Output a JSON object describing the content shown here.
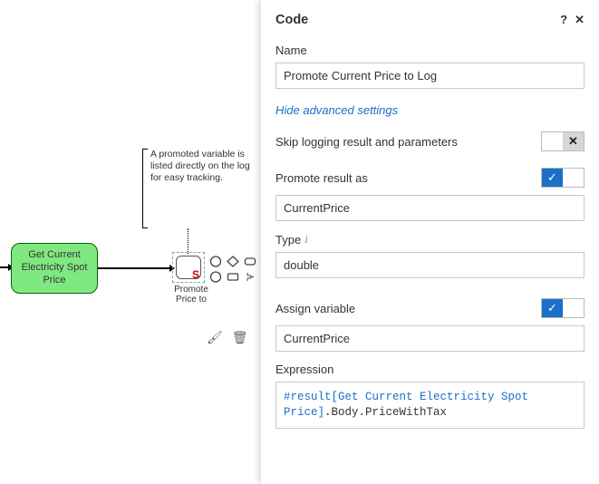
{
  "canvas": {
    "green_node_label": "Get Current Electricity Spot Price",
    "small_node_label": "Promote Price to",
    "small_node_badge": "S",
    "note_text": "A promoted variable is listed directly on the log for easy tracking."
  },
  "palette": {
    "shapes": [
      "circle",
      "diamond",
      "rounded-rect",
      "circle",
      "rect",
      "bracket"
    ],
    "tools": {
      "brush": "🖌",
      "trash": "🗑"
    }
  },
  "panel": {
    "title": "Code",
    "help_icon": "?",
    "close_icon": "✕",
    "name_label": "Name",
    "name_value": "Promote Current Price to Log",
    "hide_advanced_label": "Hide advanced settings",
    "skip_logging_label": "Skip logging result and parameters",
    "skip_logging_on": false,
    "promote_label": "Promote result as",
    "promote_on": true,
    "promote_value": "CurrentPrice",
    "type_label": "Type",
    "type_value": "double",
    "assign_label": "Assign variable",
    "assign_on": true,
    "assign_value": "CurrentPrice",
    "expression_label": "Expression",
    "expression_ref": "#result[Get Current Electricity Spot Price]",
    "expression_tail": ".Body.PriceWithTax"
  }
}
